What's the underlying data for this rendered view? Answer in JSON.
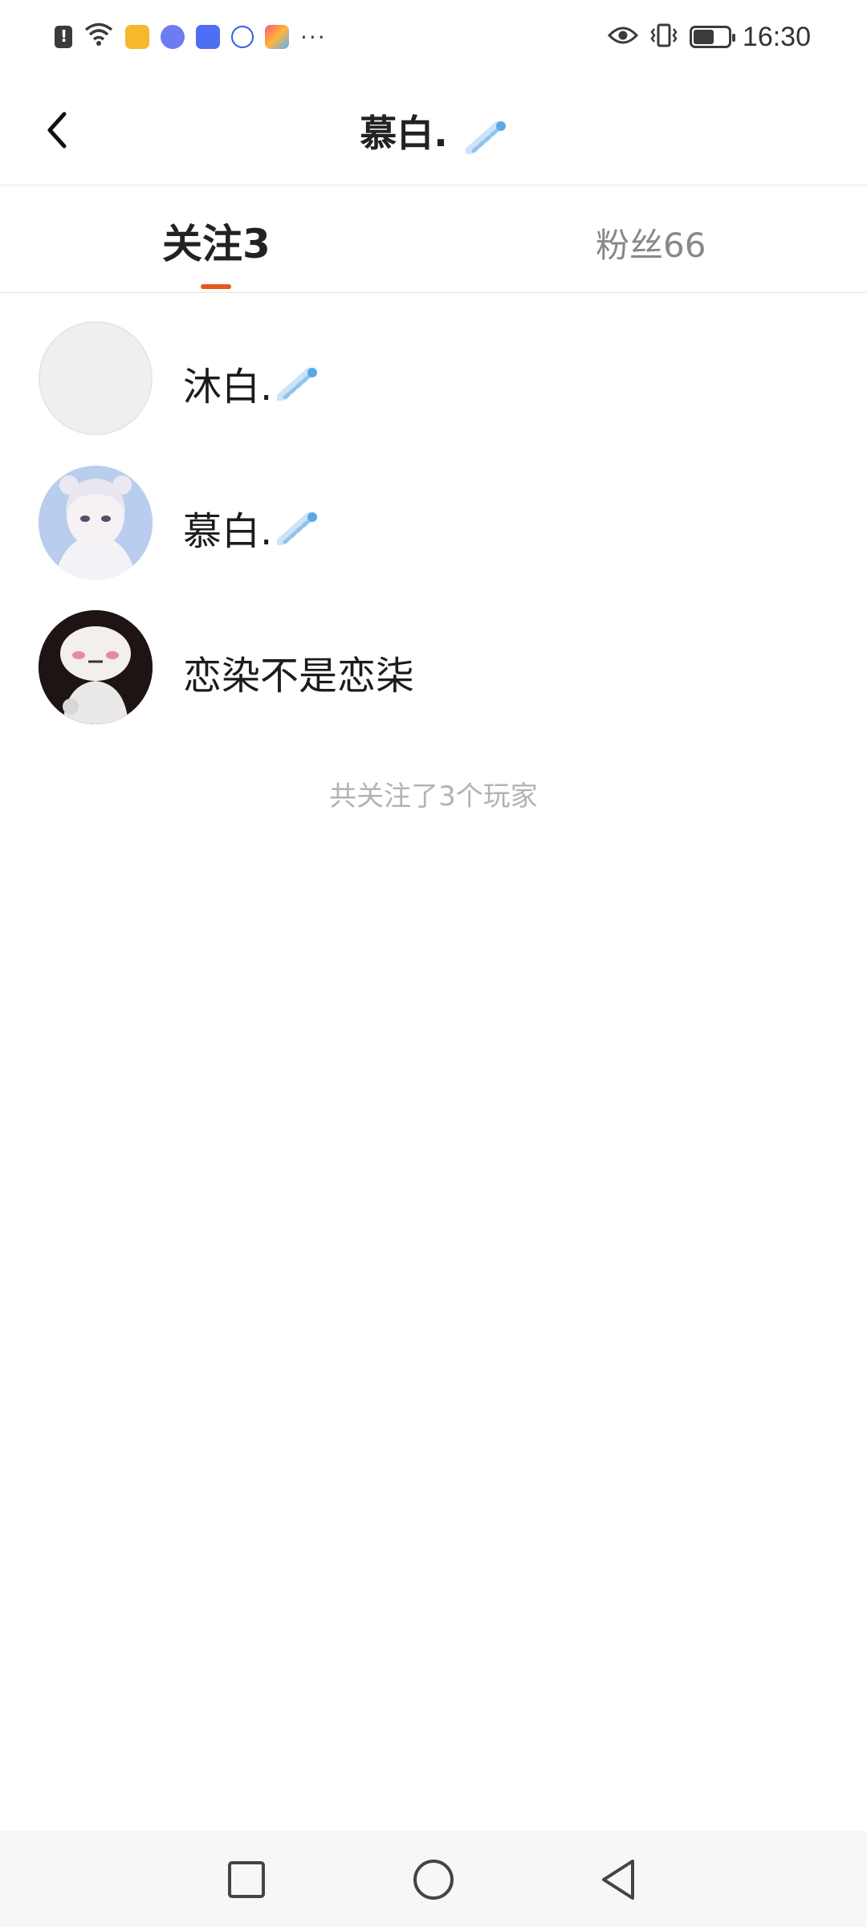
{
  "status_bar": {
    "time": "16:30",
    "left_icons": [
      "alert-icon",
      "wifi-icon",
      "app-yellow-icon",
      "music-icon",
      "app-blue-icon",
      "baidu-icon",
      "app-colorful-icon"
    ],
    "more": "···",
    "right_icons": [
      "eye-icon",
      "vibrate-icon",
      "battery-icon"
    ]
  },
  "header": {
    "title": "慕白.",
    "back_icon": "chevron-left-icon"
  },
  "tabs": [
    {
      "label": "关注3",
      "active": true
    },
    {
      "label": "粉丝66",
      "active": false
    }
  ],
  "accent_color": "#e8561c",
  "following": [
    {
      "name": "沐白.",
      "avatar": "empty",
      "badge": "comet"
    },
    {
      "name": "慕白.",
      "avatar": "anime-girl",
      "badge": "comet"
    },
    {
      "name": "恋染不是恋柒",
      "avatar": "cartoon-character",
      "badge": null
    }
  ],
  "summary": "共关注了3个玩家",
  "nav": {
    "recent_icon": "square-icon",
    "home_icon": "circle-icon",
    "back_icon": "triangle-back-icon"
  }
}
